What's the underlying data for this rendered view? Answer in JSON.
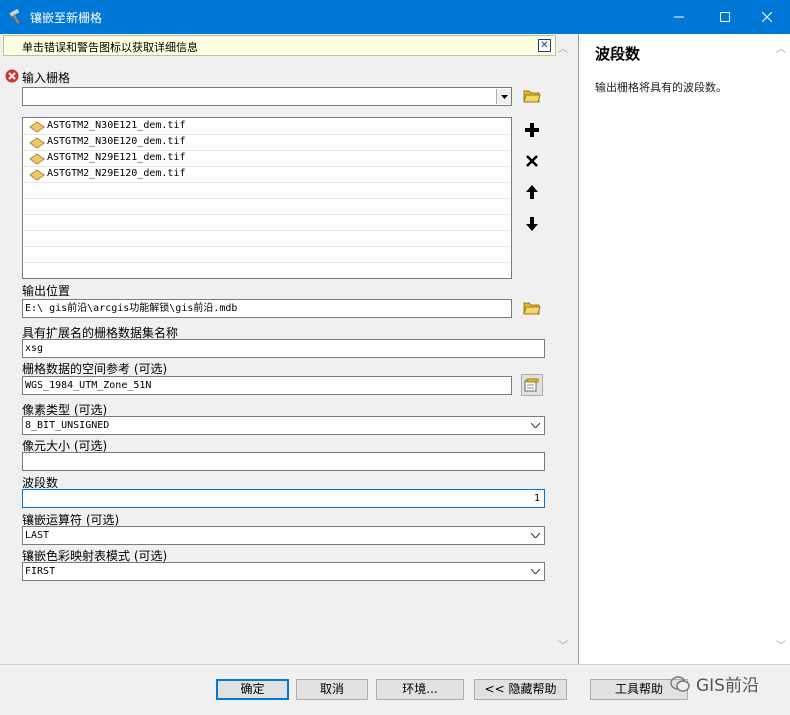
{
  "window": {
    "title": "镶嵌至新栅格"
  },
  "banner": {
    "text": "单击错误和警告图标以获取详细信息"
  },
  "input_rasters": {
    "label": "输入栅格",
    "combo_value": "",
    "files": [
      "ASTGTM2_N30E121_dem.tif",
      "ASTGTM2_N30E120_dem.tif",
      "ASTGTM2_N29E121_dem.tif",
      "ASTGTM2_N29E120_dem.tif"
    ]
  },
  "output_location": {
    "label": "输出位置",
    "value": "E:\\      gis前沿\\arcgis功能解锁\\gis前沿.mdb"
  },
  "raster_name": {
    "label": "具有扩展名的栅格数据集名称",
    "value": "xsg"
  },
  "spatial_ref": {
    "label": "栅格数据的空间参考 (可选)",
    "value": "WGS_1984_UTM_Zone_51N"
  },
  "pixel_type": {
    "label": "像素类型 (可选)",
    "value": "8_BIT_UNSIGNED"
  },
  "cell_size": {
    "label": "像元大小 (可选)",
    "value": ""
  },
  "bands": {
    "label": "波段数",
    "value": "1"
  },
  "mosaic_operator": {
    "label": "镶嵌运算符 (可选)",
    "value": "LAST"
  },
  "colormap_mode": {
    "label": "镶嵌色彩映射表模式 (可选)",
    "value": "FIRST"
  },
  "help": {
    "title": "波段数",
    "text": "输出栅格将具有的波段数。"
  },
  "buttons": {
    "ok": "确定",
    "cancel": "取消",
    "env": "环境...",
    "hide_help": "<< 隐藏帮助",
    "tool_help": "工具帮助"
  },
  "watermark": {
    "text": "GIS前沿"
  },
  "colors": {
    "titlebar": "#0078d7",
    "error": "#d32f2f",
    "banner": "#ffffe1",
    "folder": "#e8b830"
  }
}
